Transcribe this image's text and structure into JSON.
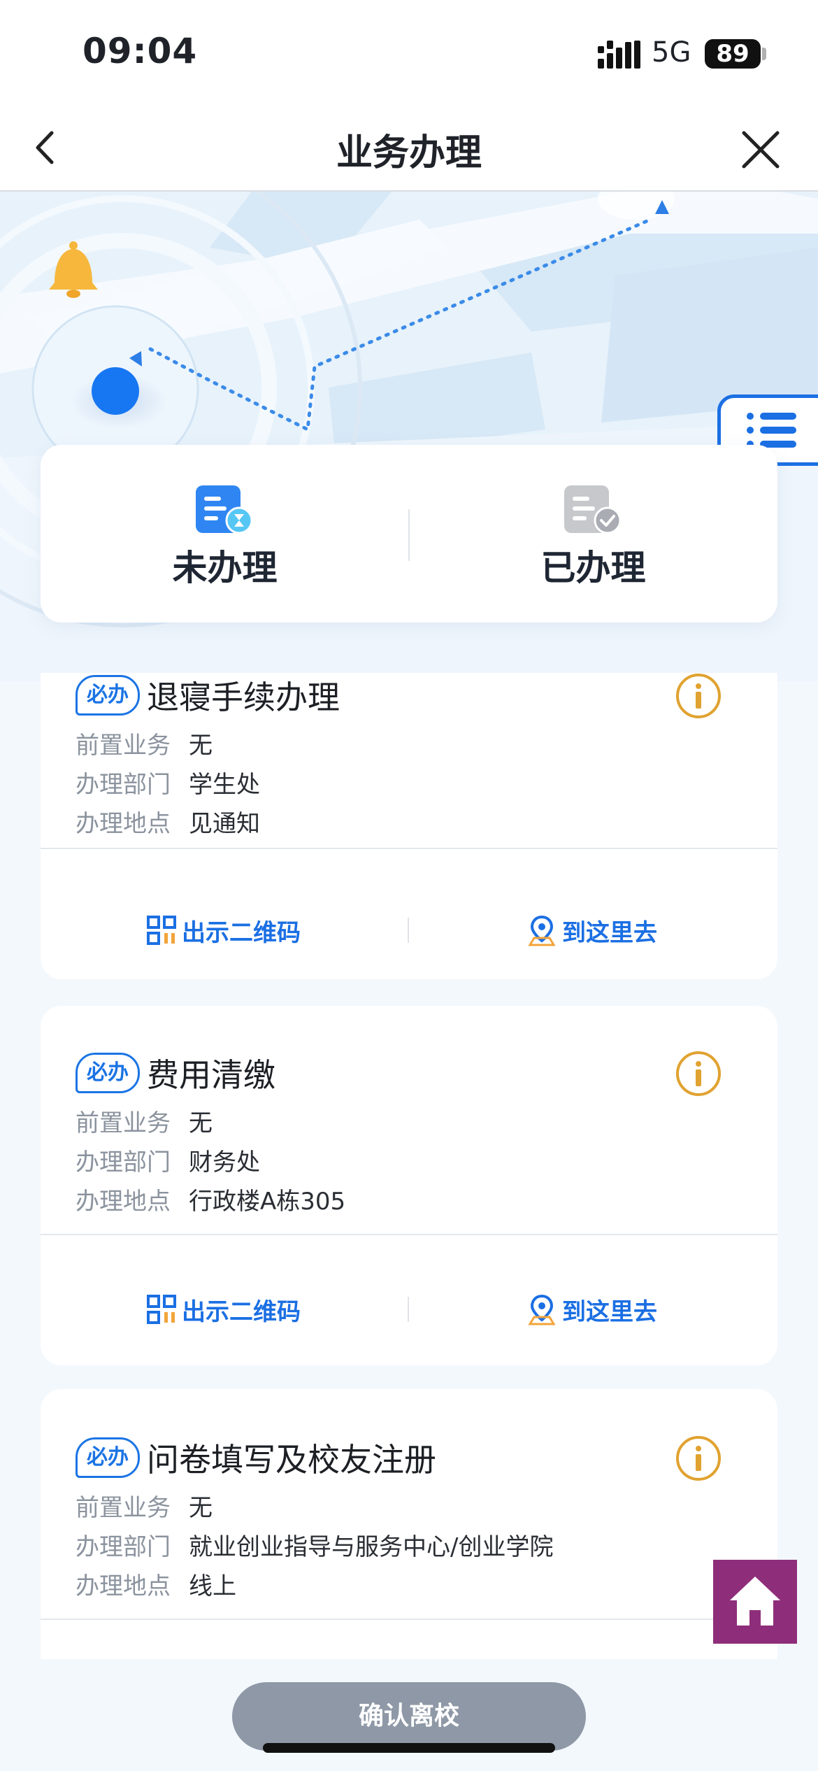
{
  "status_bar": {
    "time": "09:04",
    "network": "5G",
    "battery": "89"
  },
  "navbar": {
    "title": "业务办理"
  },
  "tabs": [
    {
      "label": "未办理",
      "icon": "pending-doc-icon"
    },
    {
      "label": "已办理",
      "icon": "done-doc-icon"
    }
  ],
  "colors": {
    "accent": "#1b6fe3",
    "info": "#e0a230",
    "home": "#8e2e7a",
    "confirm": "#8e98a6"
  },
  "field_labels": {
    "prereq": "前置业务",
    "dept": "办理部门",
    "location": "办理地点"
  },
  "badge_label": "必办",
  "actions": {
    "qr": "出示二维码",
    "navigate": "到这里去"
  },
  "cards": [
    {
      "title": "退寝手续办理",
      "prereq": "无",
      "dept": "学生处",
      "location": "见通知"
    },
    {
      "title": "费用清缴",
      "prereq": "无",
      "dept": "财务处",
      "location": "行政楼A栋305"
    },
    {
      "title": "问卷填写及校友注册",
      "prereq": "无",
      "dept": "就业创业指导与服务中心/创业学院",
      "location": "线上"
    }
  ],
  "confirm_button": "确认离校"
}
